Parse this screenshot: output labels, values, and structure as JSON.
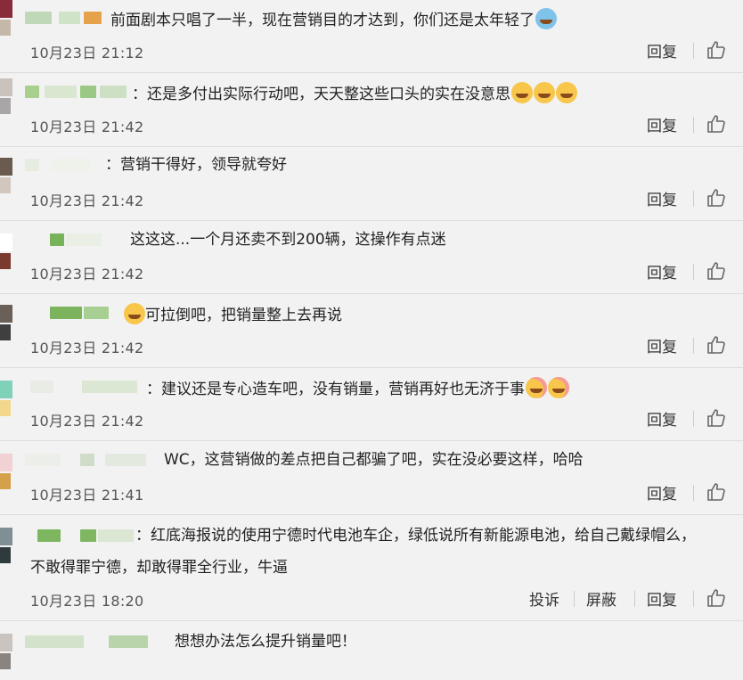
{
  "comments": [
    {
      "text": "前面剧本只唱了一半，现在营销目的才达到，你们还是太年轻了",
      "time": "10月23日 21:12",
      "emojis": [
        "tears-of-joy-emoji"
      ]
    },
    {
      "text": "：还是多付出实际行动吧，天天整这些口头的实在没意思",
      "time": "10月23日 21:42",
      "emojis": [
        "laugh-emoji",
        "laugh-emoji",
        "laugh-emoji"
      ]
    },
    {
      "text": "：营销干得好，领导就夸好",
      "time": "10月23日 21:42",
      "emojis": []
    },
    {
      "text": "这这这...一个月还卖不到200辆，这操作有点迷",
      "time": "10月23日 21:42",
      "emojis": []
    },
    {
      "text": "可拉倒吧，把销量整上去再说",
      "time": "10月23日 21:42",
      "emojis": [
        "shush-emoji"
      ]
    },
    {
      "text": "：建议还是专心造车吧，没有销量，营销再好也无济于事",
      "time": "10月23日 21:42",
      "emojis": [
        "blush-emoji",
        "blush-emoji"
      ]
    },
    {
      "text": "WC，这营销做的差点把自己都骗了吧，实在没必要这样，哈哈",
      "time": "10月23日 21:41",
      "emojis": []
    },
    {
      "text": "：红底海报说的使用宁德时代电池车企，绿低说所有新能源电池，给自己戴绿帽么，",
      "text2": "不敢得罪宁德，却敢得罪全行业，牛逼",
      "time": "10月23日 18:20",
      "emojis": []
    },
    {
      "text": "想想办法怎么提升销量吧！",
      "time": "",
      "emojis": []
    }
  ],
  "actions": {
    "reply": "回复",
    "report": "投诉",
    "block": "屏蔽"
  },
  "icons": {
    "like": "thumbs-up-icon"
  },
  "colors": {
    "background": "#f2f2f2",
    "separator": "#dcdcdc",
    "text": "#222222",
    "time": "#555555"
  }
}
